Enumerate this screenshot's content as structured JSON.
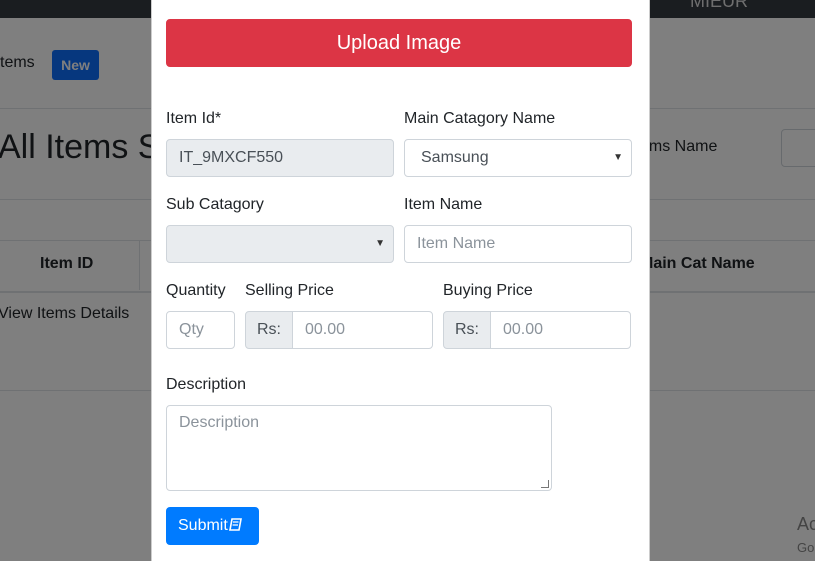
{
  "background": {
    "topbar_user": "MIEUR",
    "breadcrumb": "tems",
    "new_badge": "New",
    "page_title": "All Items S",
    "items_name_label": "ems Name",
    "table_headers": {
      "item_id": "Item ID",
      "main_cat_name": "Main Cat Name"
    },
    "view_details": "View Items Details",
    "watermark_line1": "Ac",
    "watermark_line2": "Go"
  },
  "modal": {
    "upload_button": "Upload Image",
    "item_id": {
      "label": "Item Id*",
      "value": "IT_9MXCF550"
    },
    "main_category": {
      "label": "Main Catagory Name",
      "selected": "Samsung"
    },
    "sub_category": {
      "label": "Sub Catagory",
      "selected": ""
    },
    "item_name": {
      "label": "Item Name",
      "placeholder": "Item Name"
    },
    "quantity": {
      "label": "Quantity",
      "placeholder": "Qty"
    },
    "selling_price": {
      "label": "Selling Price",
      "prefix": "Rs:",
      "placeholder": "00.00"
    },
    "buying_price": {
      "label": "Buying Price",
      "prefix": "Rs:",
      "placeholder": "00.00"
    },
    "description": {
      "label": "Description",
      "placeholder": "Description"
    },
    "submit_button": "Submit"
  },
  "colors": {
    "upload_button": "#dc3545",
    "submit_button": "#007bff",
    "new_badge": "#0d6efd",
    "topbar": "#343a40",
    "overlay": "rgba(0,0,0,0.5)"
  },
  "icons": {
    "submit": "book-icon",
    "select": "caret-down-icon"
  }
}
